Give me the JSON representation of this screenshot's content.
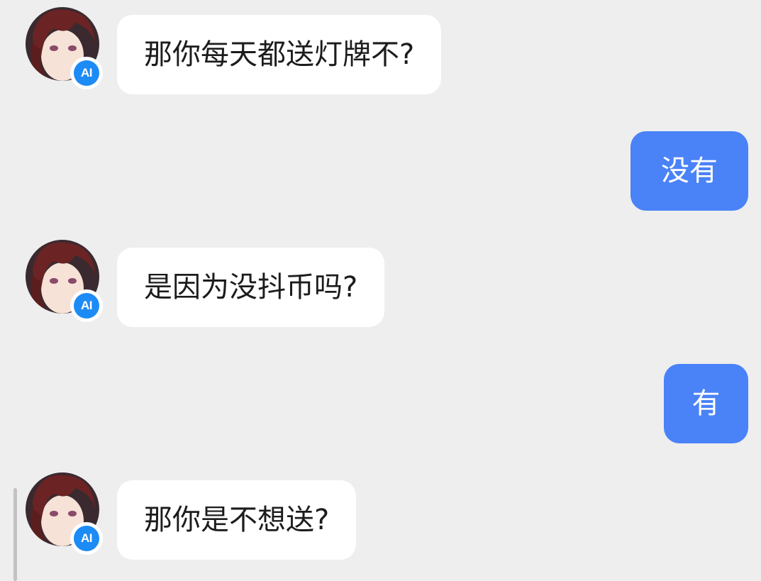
{
  "messages": [
    {
      "role": "ai",
      "text": "那你每天都送灯牌不?",
      "badge": "AI"
    },
    {
      "role": "user",
      "text": "没有"
    },
    {
      "role": "ai",
      "text": "是因为没抖币吗?",
      "badge": "AI"
    },
    {
      "role": "user",
      "text": "有"
    },
    {
      "role": "ai",
      "text": "那你是不想送?",
      "badge": "AI"
    }
  ],
  "colors": {
    "background": "#eeeeee",
    "ai_bubble": "#ffffff",
    "user_bubble": "#4a82f7",
    "badge": "#1d8bf5"
  }
}
